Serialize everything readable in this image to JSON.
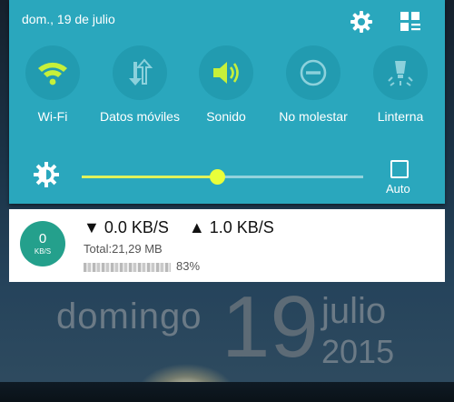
{
  "colors": {
    "panel_bg": "#2aa7bd",
    "toggle_circle": "#229bb0",
    "active_accent": "#c6f03a",
    "inactive_icon": "#8cd1dc",
    "slider_thumb": "#e9ff3a",
    "badge_bg": "#24a08c"
  },
  "header": {
    "date": "dom., 19 de julio",
    "settings_icon": "gear-icon",
    "edit_icon": "grid-edit-icon"
  },
  "toggles": [
    {
      "label": "Wi-Fi",
      "icon": "wifi-icon",
      "active": true
    },
    {
      "label": "Datos móviles",
      "icon": "mobile-data-icon",
      "active": false
    },
    {
      "label": "Sonido",
      "icon": "speaker-icon",
      "active": true
    },
    {
      "label": "No molestar",
      "icon": "do-not-disturb-icon",
      "active": false
    },
    {
      "label": "Linterna",
      "icon": "flashlight-icon",
      "active": false
    }
  ],
  "brightness": {
    "icon": "brightness-icon",
    "level_percent": 48,
    "auto_label": "Auto",
    "auto_checked": false
  },
  "notification": {
    "badge_value": "0",
    "badge_unit": "KB/S",
    "down_arrow": "▼",
    "down_speed": "0.0 KB/S",
    "up_arrow": "▲",
    "up_speed": "1.0 KB/S",
    "total": "Total:21,29 MB",
    "percent": "83%"
  },
  "lockscreen": {
    "weekday": "domingo",
    "day": "19",
    "month": "julio",
    "year": "2015"
  }
}
